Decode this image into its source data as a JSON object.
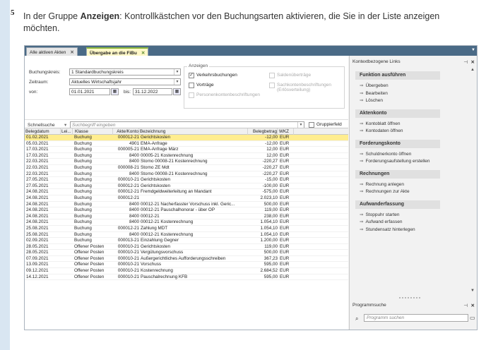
{
  "step_number": "5",
  "instruction": {
    "prefix": "In der Gruppe ",
    "bold": "Anzeigen",
    "suffix": ": Kontrollkästchen vor den Buchungsarten aktivieren, die Sie in der Liste anzeigen möchten."
  },
  "tabs": [
    {
      "label": "Alle aktiven Akten",
      "close": "✕"
    },
    {
      "label": "Übergabe an die FiBu",
      "close": "✕"
    }
  ],
  "form": {
    "buchungskreis_label": "Buchungskreis:",
    "buchungskreis_value": "1 Standardbuchungskreis",
    "zeitraum_label": "Zeitraum:",
    "zeitraum_value": "Aktuelles Wirtschaftsjahr",
    "von_label": "von:",
    "von_value": "01.01.2021",
    "bis_label": "bis:",
    "bis_value": "31.12.2022"
  },
  "anzeigen": {
    "title": "Anzeigen",
    "verkehrsbuchungen": "Verkehrsbuchungen",
    "vortraege": "Vorträge",
    "personenkonten": "Personenkontenbeschriftungen",
    "saldenuebertraege": "Saldenüberträge",
    "sachkonten": "Sachkontenbeschriftungen",
    "sachkonten2": "(Erlösverteilung)"
  },
  "search": {
    "label": "Schnellsuche",
    "placeholder": "Suchbegriff eingeben",
    "gruppenfeld": "Gruppierfeld"
  },
  "columns": [
    "Belegdatum",
    "Lei...",
    "Klasse",
    "Akte/Konto",
    "Bezeichnung",
    "Belegbetrag",
    "WKZ"
  ],
  "rows": [
    [
      "01.02.2021",
      "",
      "Buchung",
      "000012-21",
      "Gerichtskosten",
      "-12,00",
      "EUR"
    ],
    [
      "05.03.2021",
      "",
      "Buchung",
      "4901",
      "EMA-Anfrage",
      "-12,00",
      "EUR"
    ],
    [
      "17.03.2021",
      "",
      "Buchung",
      "000005-21",
      "EMA-Anfrage März",
      "12,00",
      "EUR"
    ],
    [
      "17.03.2021",
      "",
      "Buchung",
      "8400",
      "00005-21 Kostenrechnung",
      "12,00",
      "EUR"
    ],
    [
      "22.03.2021",
      "",
      "Buchung",
      "8400",
      "Storno 00008-21 Kostenrechnung",
      "-220,27",
      "EUR"
    ],
    [
      "22.03.2021",
      "",
      "Buchung",
      "000008-21",
      "Storno ZE Mdt",
      "-220,27",
      "EUR"
    ],
    [
      "22.03.2021",
      "",
      "Buchung",
      "8400",
      "Storno 00008-21 Kostenrechnung",
      "-220,27",
      "EUR"
    ],
    [
      "27.05.2021",
      "",
      "Buchung",
      "000010-21",
      "Gerichtskosten",
      "-15,00",
      "EUR"
    ],
    [
      "27.05.2021",
      "",
      "Buchung",
      "000012-21",
      "Gerichtskosten",
      "-100,00",
      "EUR"
    ],
    [
      "24.08.2021",
      "",
      "Buchung",
      "000012-21",
      "Fremdgeldweiterleitung an Mandant",
      "-575,00",
      "EUR"
    ],
    [
      "24.08.2021",
      "",
      "Buchung",
      "000012-21",
      "",
      "2.023,10",
      "EUR"
    ],
    [
      "24.08.2021",
      "",
      "Buchung",
      "8400",
      "00012-21 Nacherfasster Vorschuss inkl. Geric...",
      "500,00",
      "EUR"
    ],
    [
      "24.08.2021",
      "",
      "Buchung",
      "8400",
      "00012-21 Pauschalhonorar - über OP",
      "119,00",
      "EUR"
    ],
    [
      "24.08.2021",
      "",
      "Buchung",
      "8400",
      "00012-21",
      "238,00",
      "EUR"
    ],
    [
      "24.08.2021",
      "",
      "Buchung",
      "8400",
      "00012-21 Kostenrechnung",
      "1.054,10",
      "EUR"
    ],
    [
      "25.08.2021",
      "",
      "Buchung",
      "000012-21",
      "Zahlung MDT",
      "1.054,10",
      "EUR"
    ],
    [
      "25.08.2021",
      "",
      "Buchung",
      "8400",
      "00012-21 Kostenrechnung",
      "1.054,10",
      "EUR"
    ],
    [
      "02.09.2021",
      "",
      "Buchung",
      "000013-21",
      "Einzahlung Gegner",
      "1.200,00",
      "EUR"
    ],
    [
      "28.05.2021",
      "",
      "Offener Posten",
      "000010-21",
      "Gerichtskosten",
      "119,00",
      "EUR"
    ],
    [
      "28.05.2021",
      "",
      "Offener Posten",
      "000010-21",
      "Vergütungsvorschuss",
      "500,00",
      "EUR"
    ],
    [
      "07.09.2021",
      "",
      "Offener Posten",
      "000010-21",
      "Außergerichtliches Aufforderungsschreiben",
      "367,23",
      "EUR"
    ],
    [
      "13.09.2021",
      "",
      "Offener Posten",
      "000010-21",
      "Vorschuss",
      "595,00",
      "EUR"
    ],
    [
      "09.12.2021",
      "",
      "Offener Posten",
      "000010-21",
      "Kostenrechnung",
      "2.684,52",
      "EUR"
    ],
    [
      "14.12.2021",
      "",
      "Offener Posten",
      "000010-21",
      "Pauschalrechnung KFB",
      "595,00",
      "EUR"
    ]
  ],
  "right_panel": {
    "title": "Kontextbezogene Links",
    "sections": [
      {
        "title": "Funktion ausführen",
        "links": [
          "Übergeben",
          "Bearbeiten",
          "Löschen"
        ]
      },
      {
        "title": "Aktenkonto",
        "links": [
          "Kontoblatt öffnen",
          "Kontodaten öffnen"
        ]
      },
      {
        "title": "Forderungskonto",
        "links": [
          "Schuldnerkonto öffnen",
          "Forderungsaufstellung erstellen"
        ]
      },
      {
        "title": "Rechnungen",
        "links": [
          "Rechnung anlegen",
          "Rechnungen zur Akte"
        ]
      },
      {
        "title": "Aufwanderfassung",
        "links": [
          "Stoppuhr starten",
          "Aufwand erfassen",
          "Stundensatz hinterlegen"
        ]
      }
    ],
    "programmsuche": "Programmsuche",
    "programm_placeholder": "Programm suchen",
    "programm_oeffnen": "Programm öffnen"
  },
  "icons": {
    "arrow": "⇒",
    "pin": "⊣",
    "close": "✕",
    "search": "search-icon",
    "calendar": "calendar-icon"
  }
}
